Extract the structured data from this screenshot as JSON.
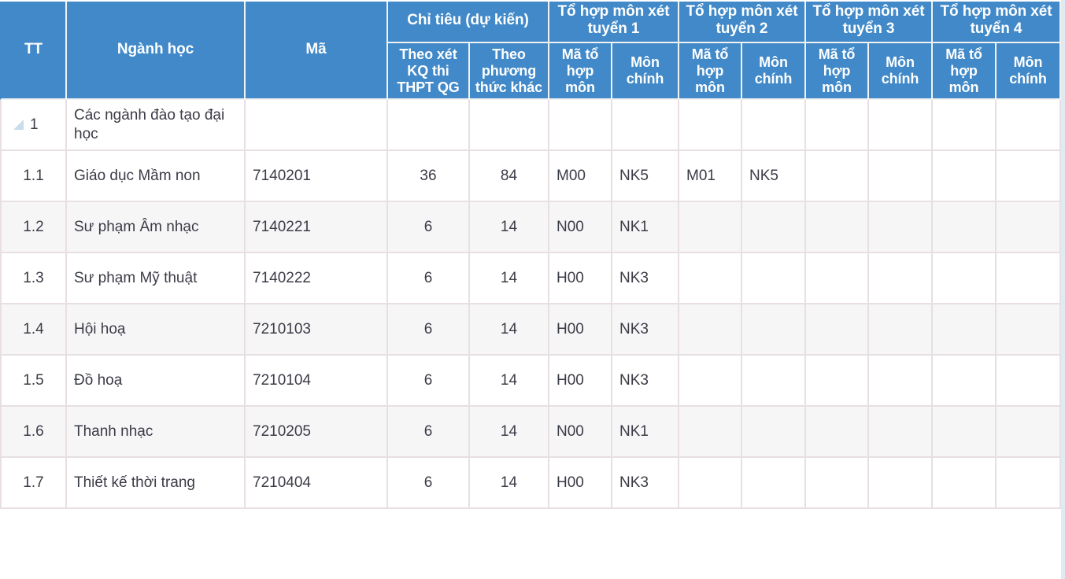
{
  "table": {
    "header": {
      "tt": "TT",
      "nganh_hoc": "Ngành học",
      "ma": "Mã",
      "chi_tieu": "Chỉ tiêu (dự kiến)",
      "chi_tieu_sub": {
        "theo_xet_kq": "Theo xét KQ thi THPT QG",
        "theo_pt_khac": "Theo phương thức khác"
      },
      "groups": [
        "Tổ hợp môn xét tuyển 1",
        "Tổ hợp môn xét tuyển 2",
        "Tổ hợp môn xét tuyển 3",
        "Tổ hợp môn xét tuyển 4"
      ],
      "group_sub": {
        "ma_to_hop_mon": "Mã tổ hợp môn",
        "mon_chinh": "Môn chính"
      }
    },
    "colors": {
      "header_bg": "#4189C8",
      "header_text": "#ffffff",
      "row_bg": "#ffffff",
      "row_alt_bg": "#f7f6f7",
      "border": "#e7dfe1",
      "body_text": "#3b3b46",
      "triangle": "#c9dcec"
    },
    "rows": [
      {
        "tt": "1",
        "nganh_hoc": "Các ngành đào tạo đại học",
        "ma": "",
        "theo_xet_kq": "",
        "theo_pt_khac": "",
        "g1_ma": "",
        "g1_mon": "",
        "g2_ma": "",
        "g2_mon": "",
        "g3_ma": "",
        "g3_mon": "",
        "g4_ma": "",
        "g4_mon": "",
        "group": true,
        "alt": false
      },
      {
        "tt": "1.1",
        "nganh_hoc": "Giáo dục Mầm non",
        "ma": "7140201",
        "theo_xet_kq": "36",
        "theo_pt_khac": "84",
        "g1_ma": "M00",
        "g1_mon": "NK5",
        "g2_ma": "M01",
        "g2_mon": "NK5",
        "g3_ma": "",
        "g3_mon": "",
        "g4_ma": "",
        "g4_mon": "",
        "group": false,
        "alt": false
      },
      {
        "tt": "1.2",
        "nganh_hoc": "Sư phạm Âm nhạc",
        "ma": "7140221",
        "theo_xet_kq": "6",
        "theo_pt_khac": "14",
        "g1_ma": "N00",
        "g1_mon": "NK1",
        "g2_ma": "",
        "g2_mon": "",
        "g3_ma": "",
        "g3_mon": "",
        "g4_ma": "",
        "g4_mon": "",
        "group": false,
        "alt": true
      },
      {
        "tt": "1.3",
        "nganh_hoc": "Sư phạm Mỹ thuật",
        "ma": "7140222",
        "theo_xet_kq": "6",
        "theo_pt_khac": "14",
        "g1_ma": "H00",
        "g1_mon": "NK3",
        "g2_ma": "",
        "g2_mon": "",
        "g3_ma": "",
        "g3_mon": "",
        "g4_ma": "",
        "g4_mon": "",
        "group": false,
        "alt": false
      },
      {
        "tt": "1.4",
        "nganh_hoc": "Hội hoạ",
        "ma": "7210103",
        "theo_xet_kq": "6",
        "theo_pt_khac": "14",
        "g1_ma": "H00",
        "g1_mon": "NK3",
        "g2_ma": "",
        "g2_mon": "",
        "g3_ma": "",
        "g3_mon": "",
        "g4_ma": "",
        "g4_mon": "",
        "group": false,
        "alt": true
      },
      {
        "tt": "1.5",
        "nganh_hoc": "Đồ hoạ",
        "ma": "7210104",
        "theo_xet_kq": "6",
        "theo_pt_khac": "14",
        "g1_ma": "H00",
        "g1_mon": "NK3",
        "g2_ma": "",
        "g2_mon": "",
        "g3_ma": "",
        "g3_mon": "",
        "g4_ma": "",
        "g4_mon": "",
        "group": false,
        "alt": false
      },
      {
        "tt": "1.6",
        "nganh_hoc": "Thanh nhạc",
        "ma": "7210205",
        "theo_xet_kq": "6",
        "theo_pt_khac": "14",
        "g1_ma": "N00",
        "g1_mon": "NK1",
        "g2_ma": "",
        "g2_mon": "",
        "g3_ma": "",
        "g3_mon": "",
        "g4_ma": "",
        "g4_mon": "",
        "group": false,
        "alt": true
      },
      {
        "tt": "1.7",
        "nganh_hoc": "Thiết kế thời trang",
        "ma": "7210404",
        "theo_xet_kq": "6",
        "theo_pt_khac": "14",
        "g1_ma": "H00",
        "g1_mon": "NK3",
        "g2_ma": "",
        "g2_mon": "",
        "g3_ma": "",
        "g3_mon": "",
        "g4_ma": "",
        "g4_mon": "",
        "group": false,
        "alt": false
      }
    ]
  }
}
